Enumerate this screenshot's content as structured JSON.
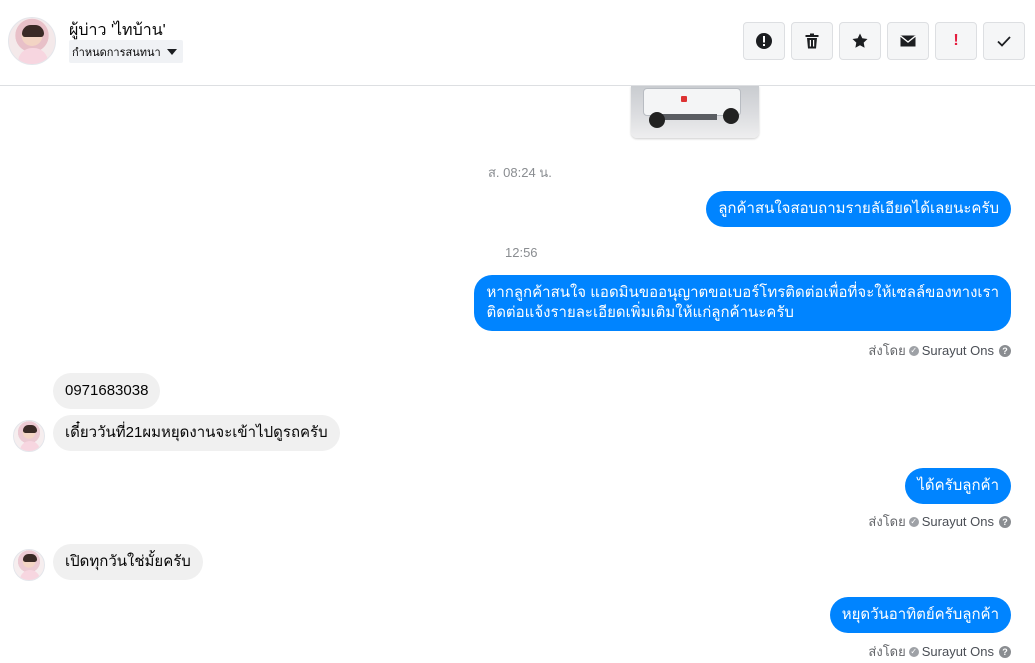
{
  "contact": {
    "name": "ผู้บ่าว 'ไทบ้าน'",
    "conversation_label": "กำหนดการสนทนา"
  },
  "toolbar": [
    {
      "name": "report-icon"
    },
    {
      "name": "trash-icon"
    },
    {
      "name": "star-icon"
    },
    {
      "name": "envelope-icon"
    },
    {
      "name": "exclamation-icon",
      "label": "!"
    },
    {
      "name": "checkmark-icon"
    }
  ],
  "messages": {
    "ts1": "ส. 08:24 น.",
    "out1": "ลูกค้าสนใจสอบถามรายลัเอียดได้เลยนะครับ",
    "ts2": "12:56",
    "out2_line1": "หากลูกค้าสนใจ แอดมินขออนุญาตขอเบอร์โทรติดต่อเพื่อที่จะให้เซลล์ของทางเรา",
    "out2_line2": "ติดต่อแจ้งรายละเอียดเพิ่มเติมให้แก่ลูกค้านะครับ",
    "in1": "0971683038",
    "in2": "เดี๋ยววันที่21ผมหยุดงานจะเข้าไปดูรถครับ",
    "out3": "ได้ครับลูกค้า",
    "in3": "เปิดทุกวันใช่มั้ยครับ",
    "out4": "หยุดวันอาทิตย์ครับลูกค้า"
  },
  "sent_by": {
    "label": "ส่งโดย",
    "agent": "Surayut Ons",
    "help": "?"
  },
  "colors": {
    "outgoing": "#0084ff",
    "incoming": "#f0f0f0",
    "danger": "#e41e3f"
  }
}
